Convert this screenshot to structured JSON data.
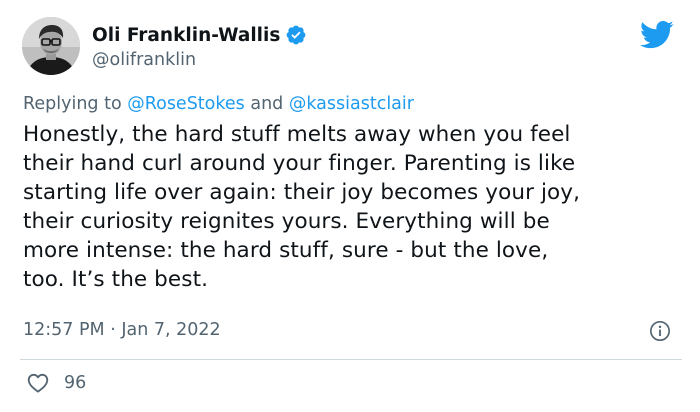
{
  "author": {
    "display_name": "Oli Franklin-Wallis",
    "handle": "@olifranklin",
    "verified": true,
    "avatar_icon": "profile-photo-man-glasses"
  },
  "reply_context": {
    "prefix": "Replying to ",
    "mention_1": "@RoseStokes",
    "conjunction": " and ",
    "mention_2": "@kassiastclair"
  },
  "tweet": {
    "lines": [
      "Honestly, the hard stuff melts away when you feel",
      "their hand curl around your finger. Parenting is like",
      "starting life over again: their joy becomes your joy,",
      "their curiosity reignites yours. Everything will be",
      "more intense: the hard stuff, sure - but the love,",
      "too. It’s the best."
    ],
    "time": "12:57 PM",
    "separator": " · ",
    "date": "Jan 7, 2022"
  },
  "actions": {
    "like_count": "96"
  },
  "colors": {
    "brand_blue": "#1d9bf0",
    "secondary_text": "#536471",
    "primary_text": "#0f1419",
    "divider": "#cfd9de"
  },
  "icons": {
    "logo": "twitter-bird-icon",
    "verified": "verified-badge-icon",
    "info": "info-icon",
    "like": "heart-icon"
  }
}
